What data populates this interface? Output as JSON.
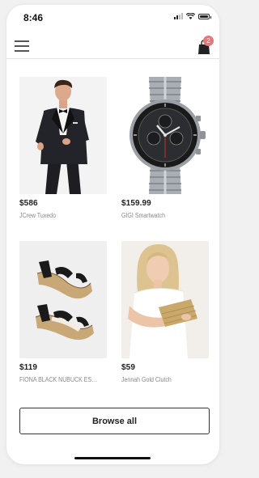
{
  "status_bar": {
    "time": "8:46"
  },
  "header": {
    "menu_icon": "hamburger-icon",
    "cart_icon": "shopping-bag-icon",
    "cart_count": "2"
  },
  "products": [
    {
      "price": "$586",
      "name": "JCrew Tuxedo",
      "image": "tuxedo-model"
    },
    {
      "price": "$159.99",
      "name": "GIGI Smartwatch",
      "image": "chronograph-watch"
    },
    {
      "price": "$119",
      "name": "FIONA BLACK NUBUCK ESPADRILLE",
      "image": "wedge-sandals"
    },
    {
      "price": "$59",
      "name": "Jennah Gold Clutch",
      "image": "woman-with-clutch"
    }
  ],
  "browse_button": {
    "label": "Browse all"
  },
  "colors": {
    "badge": "#e8767b",
    "text_primary": "#222222",
    "text_secondary": "#888888",
    "divider": "#e3e3e3"
  }
}
